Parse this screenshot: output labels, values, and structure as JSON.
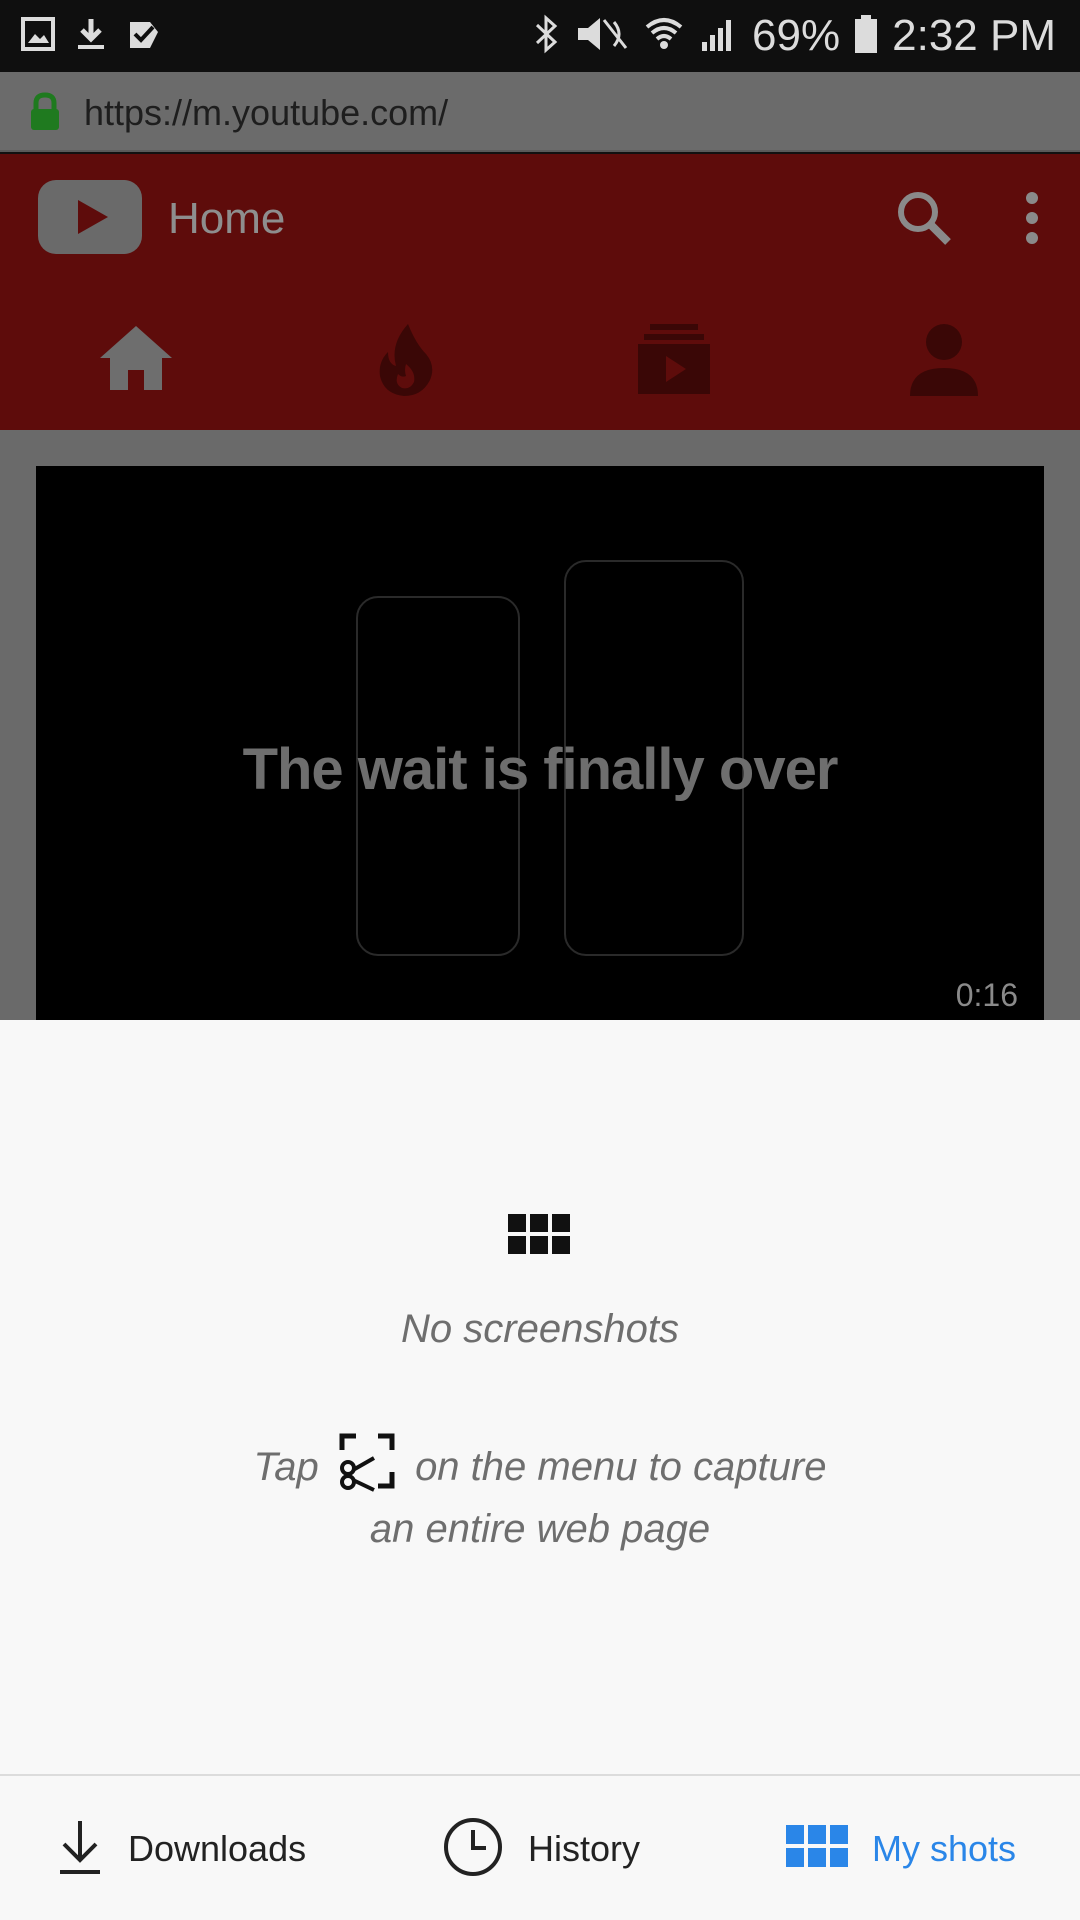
{
  "status_bar": {
    "battery_percent": "69%",
    "time": "2:32 PM",
    "left_icons": [
      "image-icon",
      "download-icon",
      "task-check-icon"
    ],
    "right_icons": [
      "bluetooth-icon",
      "mute-icon",
      "wifi-icon",
      "signal-icon",
      "battery-icon"
    ]
  },
  "url_bar": {
    "url": "https://m.youtube.com/",
    "secure_icon": "lock-icon",
    "secure_color": "#1f7a1f"
  },
  "youtube": {
    "title": "Home",
    "header_color": "#5e0c0b",
    "tabs": [
      {
        "name": "home",
        "icon": "home-icon"
      },
      {
        "name": "trending",
        "icon": "flame-icon"
      },
      {
        "name": "subscriptions",
        "icon": "subscriptions-icon"
      },
      {
        "name": "account",
        "icon": "person-icon"
      }
    ],
    "video": {
      "caption": "The wait is finally over",
      "duration": "0:16"
    }
  },
  "sheet": {
    "empty_title": "No screenshots",
    "hint_before": "Tap",
    "hint_after": "on the menu to capture",
    "hint_line2": "an entire web page"
  },
  "bottom_nav": {
    "items": [
      {
        "label": "Downloads",
        "icon": "download-icon"
      },
      {
        "label": "History",
        "icon": "clock-icon"
      },
      {
        "label": "My shots",
        "icon": "grid-icon",
        "active": true
      }
    ],
    "active_color": "#2a86e8"
  }
}
